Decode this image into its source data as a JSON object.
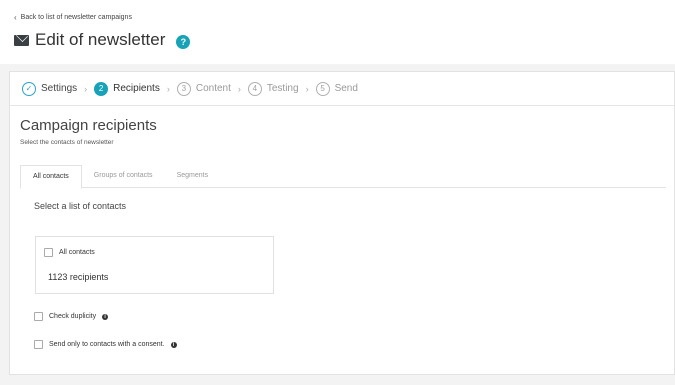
{
  "header": {
    "back_link": "Back to list of newsletter campaigns",
    "title": "Edit of newsletter",
    "help": "?"
  },
  "steps": [
    {
      "number": "✓",
      "label": "Settings",
      "state": "done"
    },
    {
      "number": "2",
      "label": "Recipients",
      "state": "active"
    },
    {
      "number": "3",
      "label": "Content",
      "state": "pending"
    },
    {
      "number": "4",
      "label": "Testing",
      "state": "pending"
    },
    {
      "number": "5",
      "label": "Send",
      "state": "pending"
    }
  ],
  "section": {
    "title": "Campaign recipients",
    "subtitle": "Select the contacts of newsletter"
  },
  "tabs": [
    "All contacts",
    "Groups of contacts",
    "Segments"
  ],
  "list": {
    "label": "Select a list of contacts",
    "option": "All contacts",
    "count": "1123 recipients"
  },
  "options": {
    "duplicity": "Check duplicity",
    "consent": "Send only to contacts with a consent."
  },
  "colors": {
    "accent": "#17a2b8"
  }
}
